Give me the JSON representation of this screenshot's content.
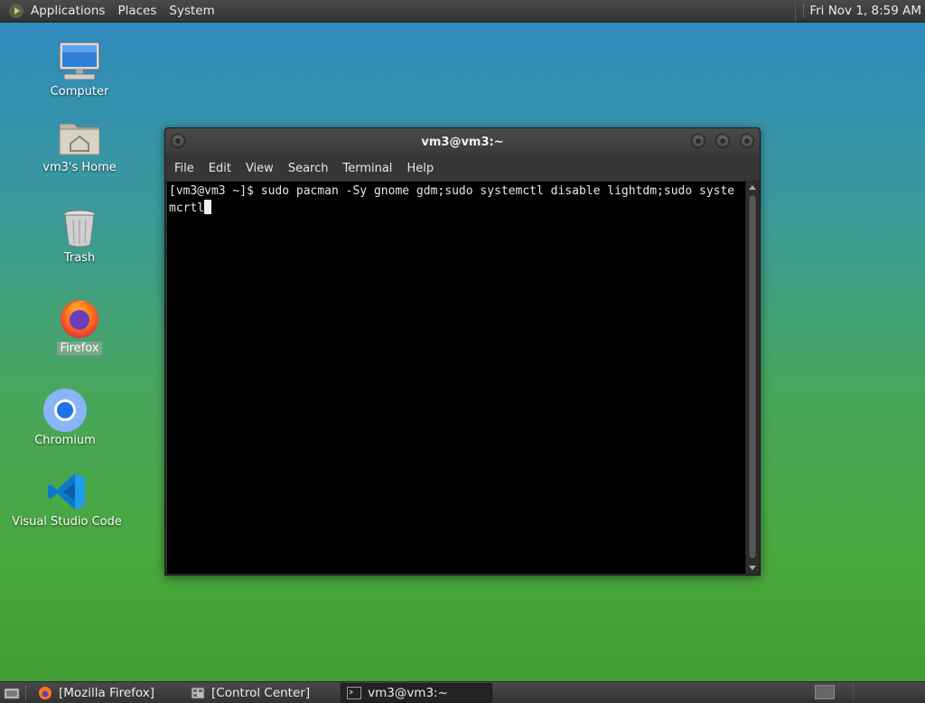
{
  "top_panel": {
    "menus": [
      "Applications",
      "Places",
      "System"
    ],
    "clock": "Fri Nov 1,  8:59 AM"
  },
  "desktop_icons": [
    {
      "label": "Computer",
      "icon": "computer-icon"
    },
    {
      "label": "vm3's Home",
      "icon": "home-folder-icon"
    },
    {
      "label": "Trash",
      "icon": "trash-icon"
    },
    {
      "label": "Firefox",
      "icon": "firefox-icon",
      "selected": true
    },
    {
      "label": "Chromium",
      "icon": "chromium-icon"
    },
    {
      "label": "Visual Studio Code",
      "icon": "vscode-icon"
    }
  ],
  "terminal": {
    "title": "vm3@vm3:~",
    "menu": [
      "File",
      "Edit",
      "View",
      "Search",
      "Terminal",
      "Help"
    ],
    "lines": [
      "[vm3@vm3 ~]$ sudo pacman -Sy gnome gdm;sudo systemctl disable lightdm;sudo syste",
      "mcrtl"
    ]
  },
  "taskbar": {
    "tasks": [
      {
        "label": "[Mozilla Firefox]",
        "icon": "firefox-icon",
        "active": false
      },
      {
        "label": "[Control Center]",
        "icon": "control-center-icon",
        "active": false
      },
      {
        "label": "vm3@vm3:~",
        "icon": "terminal-icon",
        "active": true
      }
    ]
  },
  "colors": {
    "panel": "#3c3c3c",
    "terminal_bg": "#000000",
    "terminal_fg": "#e8e8e8",
    "desktop_top": "#2f88c2",
    "desktop_bottom": "#3f9a32"
  }
}
